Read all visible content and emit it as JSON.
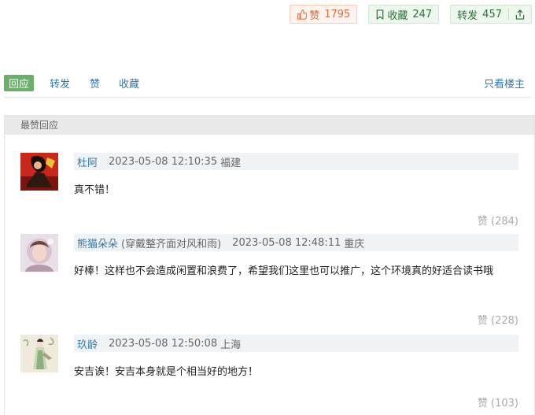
{
  "actions": {
    "like": {
      "label": "赞",
      "count": "1795"
    },
    "collect": {
      "label": "收藏",
      "count": "247"
    },
    "share": {
      "label": "转发",
      "count": "457"
    }
  },
  "tabs": [
    {
      "label": "回应",
      "active": true
    },
    {
      "label": "转发"
    },
    {
      "label": "赞"
    },
    {
      "label": "收藏"
    }
  ],
  "only_op_label": "只看楼主",
  "section_title": "最赞回应",
  "comments": [
    {
      "name": "杜阿",
      "signature": "",
      "time": "2023-05-08 12:10:35",
      "location": "福建",
      "text": "真不错！",
      "votes": "赞 (284)"
    },
    {
      "name": "熊猫朵朵",
      "signature": "(穿戴整齐面对风和雨)",
      "time": "2023-05-08 12:48:11",
      "location": "重庆",
      "text": "好棒！这样也不会造成闲置和浪费了，希望我们这里也可以推广，这个环境真的好适合读书哦",
      "votes": "赞 (228)"
    },
    {
      "name": "玖龄",
      "signature": "",
      "time": "2023-05-08 12:50:08",
      "location": "上海",
      "text": "安吉诶！安吉本身就是个相当好的地方！",
      "votes": "赞 (103)"
    }
  ]
}
